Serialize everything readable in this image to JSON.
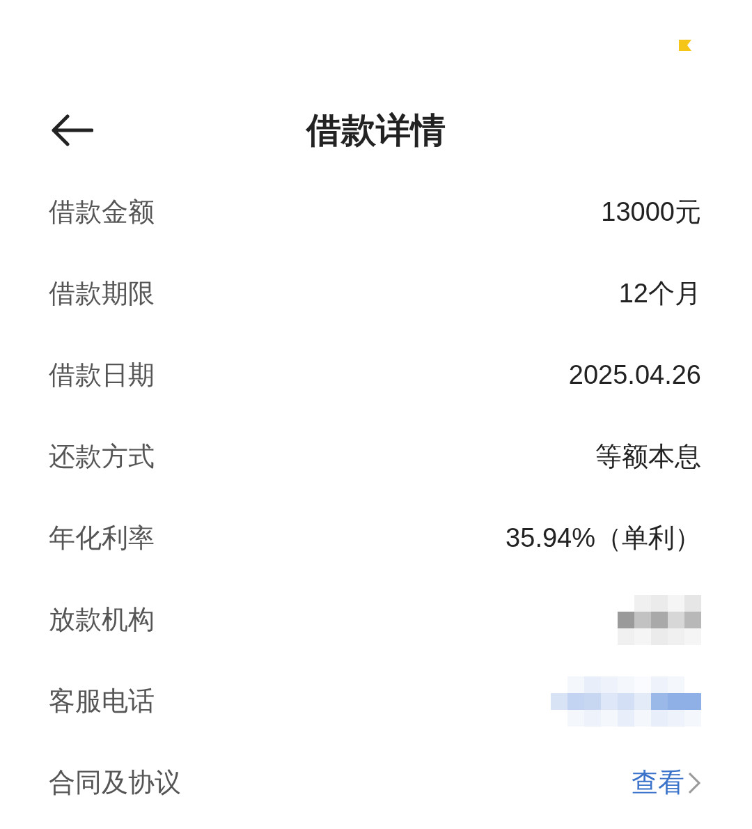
{
  "header": {
    "title": "借款详情"
  },
  "rows": [
    {
      "label": "借款金额",
      "kind": "text",
      "value": "13000元"
    },
    {
      "label": "借款期限",
      "kind": "text",
      "value": "12个月"
    },
    {
      "label": "借款日期",
      "kind": "text",
      "value": "2025.04.26"
    },
    {
      "label": "还款方式",
      "kind": "text",
      "value": "等额本息"
    },
    {
      "label": "年化利率",
      "kind": "text",
      "value": "35.94%（单利）"
    },
    {
      "label": "放款机构",
      "kind": "redacted",
      "color": "#9a9a9a"
    },
    {
      "label": "客服电话",
      "kind": "redacted",
      "color": "#8fb0e6"
    },
    {
      "label": "合同及协议",
      "kind": "link",
      "value": "查看"
    }
  ]
}
